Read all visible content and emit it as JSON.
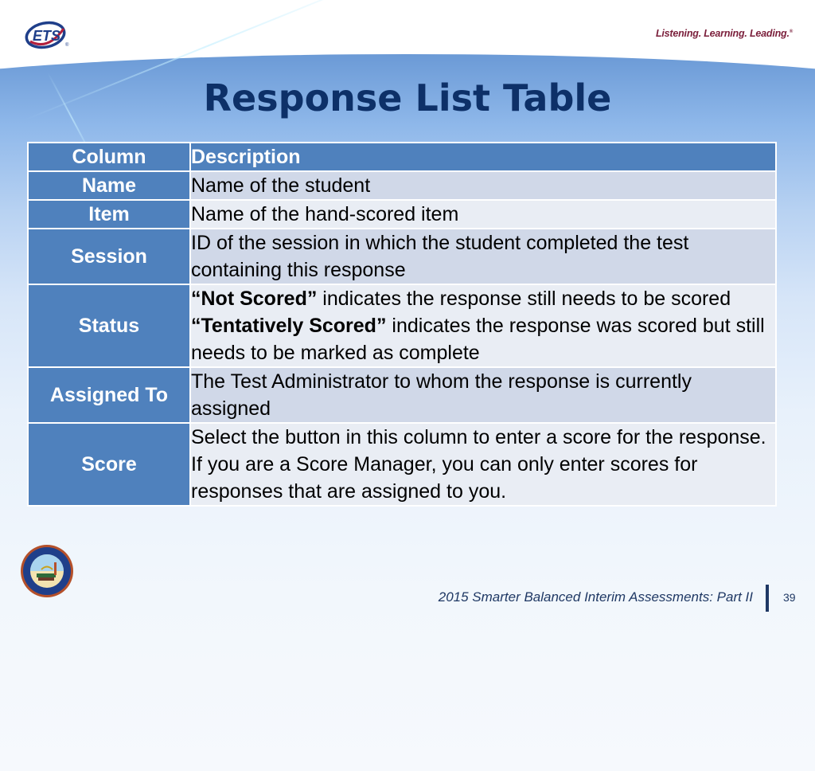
{
  "header": {
    "logo": "ETS",
    "tagline": "Listening. Learning. Leading.",
    "tagline_mark": "®"
  },
  "title": "Response List Table",
  "table": {
    "headers": [
      "Column",
      "Description"
    ],
    "rows": [
      {
        "name": "Name",
        "description": [
          {
            "text": "Name of the student",
            "bold": false
          }
        ]
      },
      {
        "name": "Item",
        "description": [
          {
            "text": "Name of the hand-scored item",
            "bold": false
          }
        ]
      },
      {
        "name": "Session",
        "description": [
          {
            "text": "ID of the session in which the student completed the test containing this response",
            "bold": false
          }
        ]
      },
      {
        "name": "Status",
        "description": [
          {
            "text": "“Not Scored”",
            "bold": true
          },
          {
            "text": " indicates the response still needs to be scored",
            "bold": false
          },
          {
            "text": "BR"
          },
          {
            "text": "“Tentatively Scored”",
            "bold": true
          },
          {
            "text": " indicates the response was scored but still needs to be marked as complete",
            "bold": false
          }
        ]
      },
      {
        "name": "Assigned To",
        "description": [
          {
            "text": "The Test Administrator to whom the response is currently assigned",
            "bold": false
          }
        ]
      },
      {
        "name": "Score",
        "description": [
          {
            "text": "Select the button in this column to enter a score for the response. If you are a Score Manager, you can only enter scores for responses that are assigned to you.",
            "bold": false
          }
        ]
      }
    ]
  },
  "footer": {
    "seal": "Department of Education State of California seal",
    "text": "2015 Smarter Balanced Interim Assessments: Part II",
    "page_number": "39"
  },
  "colors": {
    "header_blue": "#4f81bd",
    "title_navy": "#0d3068",
    "row_odd": "#d0d8e8",
    "row_even": "#e9edf4",
    "tagline_maroon": "#7a1e3a"
  }
}
